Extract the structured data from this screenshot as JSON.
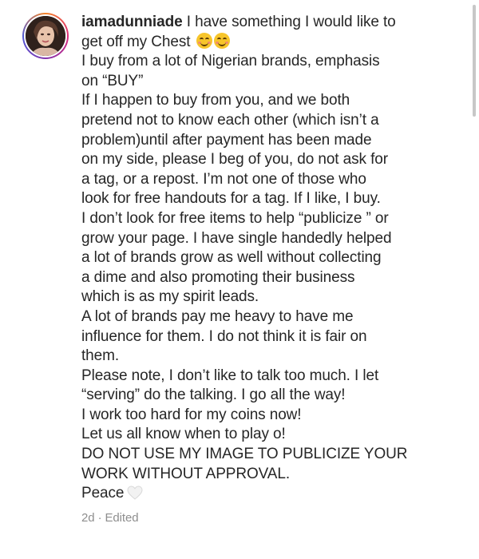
{
  "post": {
    "username": "iamadunniade",
    "lines": [
      "get off my Chest",
      "I buy from a lot of Nigerian brands, emphasis",
      "on “BUY”",
      "If I happen to buy from you, and we both",
      "pretend not to know each other (which isn’t a",
      "problem)until after payment has been made",
      "on my side, please I beg of you, do not ask for",
      "a tag, or a repost. I’m not one of those who",
      "look for free handouts for a tag. If I like, I buy.",
      "I don’t look for free items to help “publicize ” or",
      "grow your page.  I have single handedly helped",
      "a lot of brands grow as well without collecting",
      "a dime and also promoting their business",
      "which is as my spirit leads.",
      "A lot of brands pay me heavy to have me",
      "influence for them. I do not think it is fair on",
      "them.",
      "Please note, I don’t like to talk too much. I let",
      "“serving” do the talking. I go all the way!",
      "I work too hard for my coins now!",
      "Let us all know when to play o!",
      "DO NOT USE MY IMAGE TO PUBLICIZE YOUR",
      "WORK WITHOUT APPROVAL.",
      "Peace"
    ],
    "first_line_text": " I have something I would like to",
    "age": "2d",
    "separator": " · ",
    "edited": "Edited",
    "icons": {
      "emoji": "smiling-face-icon",
      "heart": "white-heart-icon"
    },
    "colors": {
      "text": "#262626",
      "meta": "#8e8e8e",
      "story_ring": "#dd2a7b"
    }
  }
}
